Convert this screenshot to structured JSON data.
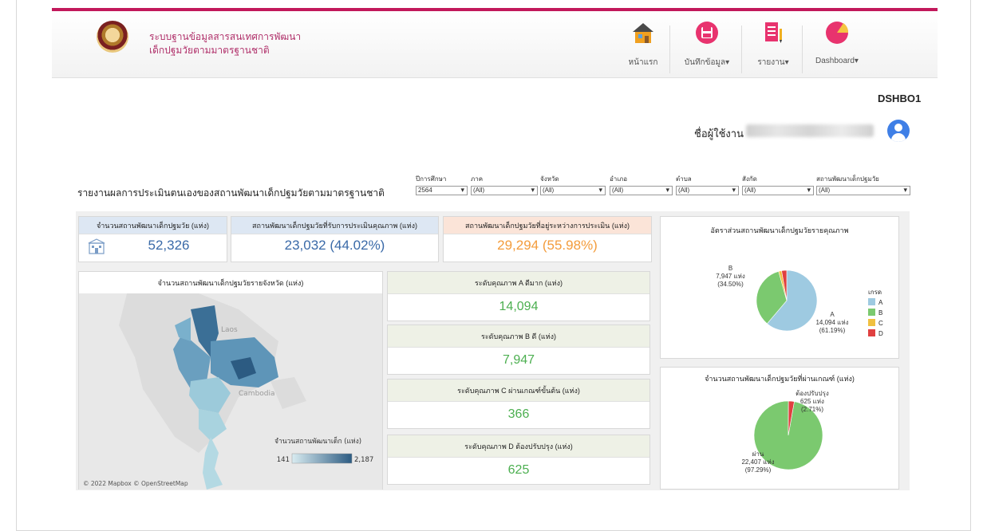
{
  "header": {
    "title_line1": "ระบบฐานข้อมูลสารสนเทศการพัฒนา",
    "title_line2": "เด็กปฐมวัยตามมาตรฐานชาติ",
    "nav": [
      {
        "label": "หน้าแรก"
      },
      {
        "label": "บันทึกข้อมูล▾"
      },
      {
        "label": "รายงาน▾"
      },
      {
        "label": "Dashboard▾"
      }
    ]
  },
  "page_code": "DSHBO1",
  "user": {
    "label": "ชื่อผู้ใช้งาน"
  },
  "report_title": "รายงานผลการประเมินตนเองของสถานพัฒนาเด็กปฐมวัยตามมาตรฐานชาติ",
  "filters": [
    {
      "label": "ปีการศึกษา",
      "value": "2564"
    },
    {
      "label": "ภาค",
      "value": "(All)"
    },
    {
      "label": "จังหวัด",
      "value": "(All)"
    },
    {
      "label": "อำเภอ",
      "value": "(All)"
    },
    {
      "label": "ตำบล",
      "value": "(All)"
    },
    {
      "label": "สังกัด",
      "value": "(All)"
    },
    {
      "label": "สถานพัฒนาเด็กปฐมวัย",
      "value": "(All)"
    }
  ],
  "kpis": {
    "total": {
      "label": "จำนวนสถานพัฒนาเด็กปฐมวัย (แห่ง)",
      "value": "52,326"
    },
    "assessed": {
      "label": "สถานพัฒนาเด็กปฐมวัยที่รับการประเมินคุณภาพ (แห่ง)",
      "value": "23,032 (44.02%)"
    },
    "pending": {
      "label": "สถานพัฒนาเด็กปฐมวัยที่อยู่ระหว่างการประเมิน (แห่ง)",
      "value": "29,294 (55.98%)"
    }
  },
  "map": {
    "title": "จำนวนสถานพัฒนาเด็กปฐมวัยรายจังหวัด (แห่ง)",
    "labels": {
      "laos": "Laos",
      "cambodia": "Cambodia"
    },
    "legend_title": "จำนวนสถานพัฒนาเด็ก (แห่ง)",
    "legend_min": "141",
    "legend_max": "2,187",
    "attribution": "© 2022 Mapbox © OpenStreetMap"
  },
  "grades": [
    {
      "label": "ระดับคุณภาพ A ดีมาก (แห่ง)",
      "value": "14,094"
    },
    {
      "label": "ระดับคุณภาพ B ดี (แห่ง)",
      "value": "7,947"
    },
    {
      "label": "ระดับคุณภาพ C ผ่านเกณฑ์ขั้นต้น (แห่ง)",
      "value": "366"
    },
    {
      "label": "ระดับคุณภาพ D ต้องปรับปรุง (แห่ง)",
      "value": "625"
    }
  ],
  "colors": {
    "A": "#9ecae1",
    "B": "#7bc96f",
    "C": "#f0c040",
    "D": "#e04040",
    "pass": "#7bc96f",
    "fail": "#e04040",
    "kpi_blue": "#3a6aa8",
    "kpi_orange": "#f39c3c",
    "grade_green": "#4caf50"
  },
  "pie1": {
    "title": "อัตราส่วนสถานพัฒนาเด็กปฐมวัยรายคุณภาพ",
    "legend_title": "เกรด",
    "label_b": [
      "B",
      "7,947 แห่ง",
      "(34.50%)"
    ],
    "label_a": [
      "A",
      "14,094 แห่ง",
      "(61.19%)"
    ]
  },
  "pie2": {
    "title": "จำนวนสถานพัฒนาเด็กปฐมวัยที่ผ่านเกณฑ์ (แห่ง)",
    "label_fail": [
      "ต้องปรับปรุง",
      "625 แห่ง",
      "(2.71%)"
    ],
    "label_pass": [
      "ผ่าน",
      "22,407 แห่ง",
      "(97.29%)"
    ]
  },
  "chart_data": [
    {
      "type": "pie",
      "title": "อัตราส่วนสถานพัฒนาเด็กปฐมวัยรายคุณภาพ",
      "categories": [
        "A",
        "B",
        "C",
        "D"
      ],
      "values": [
        14094,
        7947,
        366,
        625
      ],
      "legend": "right"
    },
    {
      "type": "pie",
      "title": "จำนวนสถานพัฒนาเด็กปฐมวัยที่ผ่านเกณฑ์ (แห่ง)",
      "categories": [
        "ผ่าน",
        "ต้องปรับปรุง"
      ],
      "values": [
        22407,
        625
      ]
    }
  ]
}
